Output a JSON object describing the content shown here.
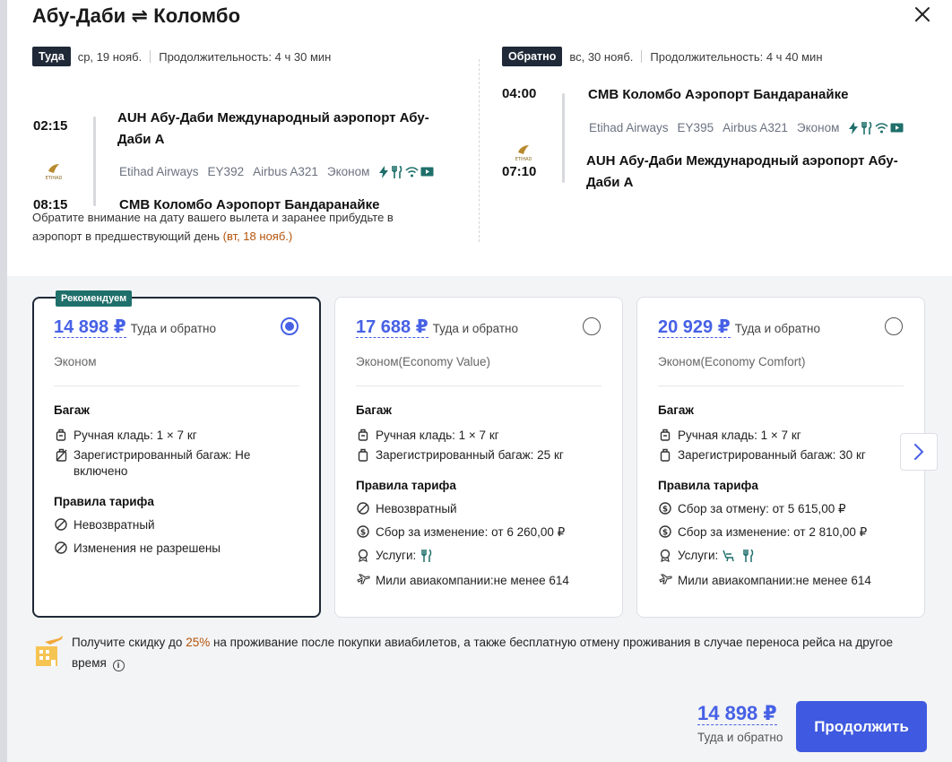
{
  "title": "Абу-Даби ⇌ Коломбо",
  "outbound": {
    "badge": "Туда",
    "date": "ср, 19 нояб.",
    "duration": "Продолжительность: 4 ч 30 мин",
    "dep_time": "02:15",
    "arr_time": "08:15",
    "dep_airport_line1": "AUH Абу-Даби Международный аэропорт Абу-",
    "dep_airport_line2": "Даби A",
    "airline": "Etihad Airways",
    "flight": "EY392",
    "aircraft": "Airbus A321",
    "cabin": "Эконом",
    "arr_airport": "CMB Коломбо Аэропорт Бандаранайке"
  },
  "return": {
    "badge": "Обратно",
    "date": "вс, 30 нояб.",
    "duration": "Продолжительность: 4 ч 40 мин",
    "dep_time": "04:00",
    "arr_time": "07:10",
    "dep_airport": "CMB Коломбо Аэропорт Бандаранайке",
    "airline": "Etihad Airways",
    "flight": "EY395",
    "aircraft": "Airbus A321",
    "cabin": "Эконом",
    "arr_airport_line1": "AUH Абу-Даби Международный аэропорт Абу-",
    "arr_airport_line2": "Даби A"
  },
  "note": {
    "text": "Обратите внимание на дату вашего вылета и заранее прибудьте в аэропорт в предшествующий день ",
    "date": "(вт, 18 нояб.)"
  },
  "fares": [
    {
      "recommended": "Рекомендуем",
      "price": "14 898 ₽",
      "price_note": "Туда и обратно",
      "cabin": "Эконом",
      "selected": true,
      "baggage_title": "Багаж",
      "carry_on": "Ручная кладь: 1 × 7 кг",
      "checked": "Зарегистрированный багаж: Не включено",
      "rules_title": "Правила тарифа",
      "rule1": "Невозвратный",
      "rule2": "Изменения не разрешены"
    },
    {
      "price": "17 688 ₽",
      "price_note": "Туда и обратно",
      "cabin": "Эконом(Economy Value)",
      "selected": false,
      "baggage_title": "Багаж",
      "carry_on": "Ручная кладь: 1 × 7 кг",
      "checked": "Зарегистрированный багаж: 25 кг",
      "rules_title": "Правила тарифа",
      "rule1": "Невозвратный",
      "rule2": "Сбор за изменение: от 6 260,00 ₽",
      "rule3": "Услуги:",
      "rule4": "Мили авиакомпании:не менее 614"
    },
    {
      "price": "20 929 ₽",
      "price_note": "Туда и обратно",
      "cabin": "Эконом(Economy Comfort)",
      "selected": false,
      "baggage_title": "Багаж",
      "carry_on": "Ручная кладь: 1 × 7 кг",
      "checked": "Зарегистрированный багаж: 30 кг",
      "rules_title": "Правила тарифа",
      "rule1": "Сбор за отмену: от 5 615,00 ₽",
      "rule2": "Сбор за изменение: от 2 810,00 ₽",
      "rule3": "Услуги:",
      "rule4": "Мили авиакомпании:не менее 614"
    }
  ],
  "promo": {
    "pre": "Получите скидку до ",
    "pct": "25%",
    "post": " на проживание после покупки авиабилетов, а также бесплатную отмену проживания в случае переноса рейса на другое время"
  },
  "total": {
    "price": "14 898 ₽",
    "note": "Туда и обратно"
  },
  "cta": "Продолжить",
  "colors": {
    "accent": "#4661e6",
    "badge_dark": "#1f2937",
    "rec_badge": "#1f6f6b",
    "date_highlight": "#b45309",
    "icon_teal": "#1f6f6b"
  }
}
